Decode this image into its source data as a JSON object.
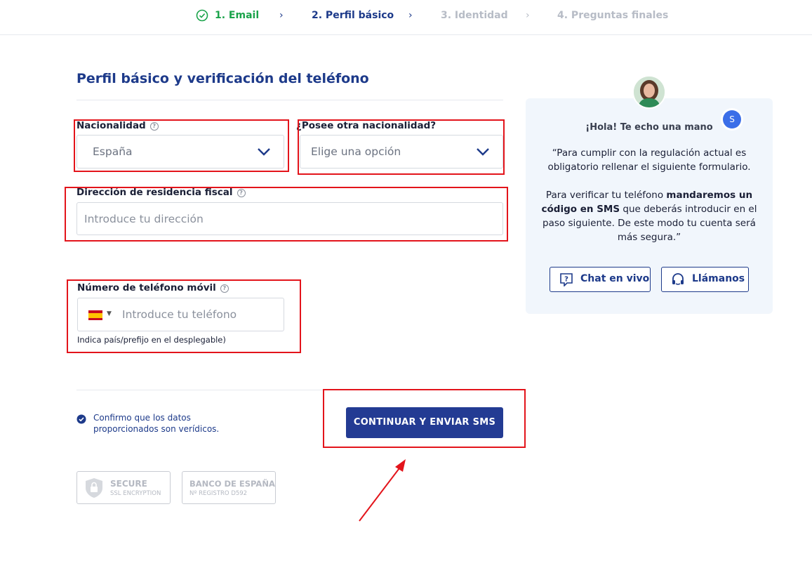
{
  "stepper": {
    "steps": [
      {
        "label": "1. Email",
        "state": "done"
      },
      {
        "label": "2. Perfil básico",
        "state": "active"
      },
      {
        "label": "3. Identidad",
        "state": "todo"
      },
      {
        "label": "4. Preguntas finales",
        "state": "todo"
      }
    ]
  },
  "form": {
    "title": "Perfil básico y verificación del teléfono",
    "nationality": {
      "label": "Nacionalidad",
      "value": "España"
    },
    "other_nationality": {
      "label": "¿Posee otra nacionalidad?",
      "placeholder": "Elige una opción"
    },
    "address": {
      "label": "Dirección de residencia fiscal",
      "placeholder": "Introduce tu dirección"
    },
    "phone": {
      "label": "Número de teléfono móvil",
      "placeholder": "Introduce tu teléfono",
      "hint": "Indica país/prefijo en el desplegable)"
    },
    "confirm_text": "Confirmo que los datos proporcionados son verídicos.",
    "submit_label": "CONTINUAR Y ENVIAR SMS"
  },
  "badges": {
    "secure": {
      "title": "SECURE",
      "subtitle": "SSL ENCRYPTION"
    },
    "bank": {
      "title": "BANCO DE ESPAÑA",
      "subtitle": "Nº REGISTRO D592"
    }
  },
  "help": {
    "greeting": "¡Hola! Te echo una mano",
    "agent_initial": "S",
    "message_part1": "“Para cumplir con la regulación actual es obligatorio rellenar el siguiente formulario.",
    "message_part2_pre": "Para verificar tu teléfono ",
    "message_part2_bold": "mandaremos un código en SMS",
    "message_part2_post": " que deberás introducir en el paso siguiente. De este modo tu cuenta será más segura.”",
    "chat_label": "Chat en vivo",
    "call_label": "Llámanos"
  },
  "colors": {
    "brand": "#233b93",
    "success": "#1aa34a",
    "annotation": "#e3141b"
  }
}
